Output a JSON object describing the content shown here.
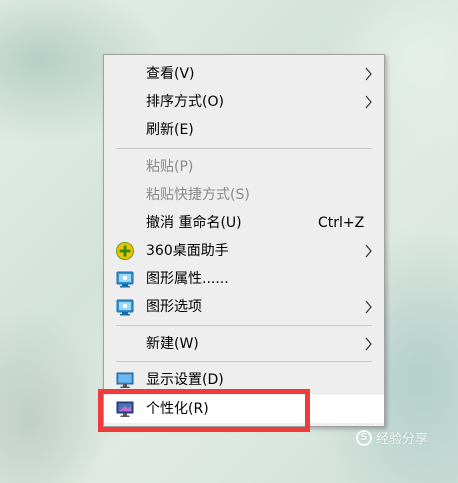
{
  "context_menu": {
    "items": [
      {
        "label": "查看(V)",
        "has_submenu": true
      },
      {
        "label": "排序方式(O)",
        "has_submenu": true
      },
      {
        "label": "刷新(E)"
      },
      {
        "label": "粘贴(P)",
        "disabled": true
      },
      {
        "label": "粘贴快捷方式(S)",
        "disabled": true
      },
      {
        "label": "撤消 重命名(U)",
        "shortcut": "Ctrl+Z"
      },
      {
        "label": "360桌面助手",
        "icon": "360-assistant-icon",
        "has_submenu": true
      },
      {
        "label": "图形属性......",
        "icon": "graphics-properties-icon"
      },
      {
        "label": "图形选项",
        "icon": "graphics-options-icon",
        "has_submenu": true
      },
      {
        "label": "新建(W)",
        "has_submenu": true
      },
      {
        "label": "显示设置(D)",
        "icon": "display-settings-icon"
      },
      {
        "label": "个性化(R)",
        "icon": "personalize-icon",
        "highlighted": true
      }
    ]
  },
  "watermark": {
    "text": "经验分享"
  },
  "colors": {
    "highlight_box": "#ee3b3b",
    "menu_bg": "#eeeeee",
    "disabled_text": "#8a8a8a"
  }
}
